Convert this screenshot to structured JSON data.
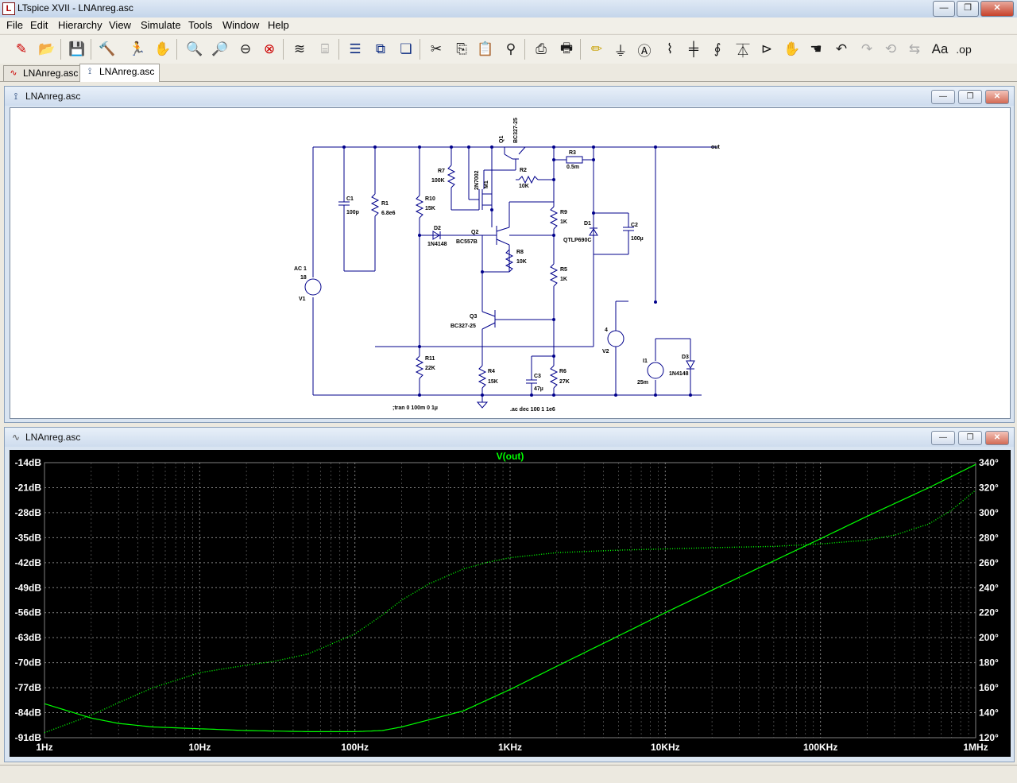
{
  "app": {
    "title": "LTspice XVII - LNAnreg.asc",
    "icon_letter": "L"
  },
  "window_controls": {
    "minimize": "—",
    "restore": "❐",
    "close": "✕"
  },
  "menu": [
    "File",
    "Edit",
    "Hierarchy",
    "View",
    "Simulate",
    "Tools",
    "Window",
    "Help"
  ],
  "tabs": [
    {
      "label": "LNAnreg.asc",
      "kind": "waveform",
      "active": false
    },
    {
      "label": "LNAnreg.asc",
      "kind": "schematic",
      "active": true
    }
  ],
  "schematic_window": {
    "title": "LNAnreg.asc",
    "labels": {
      "q1": "Q1",
      "q1_model": "BC327-25",
      "out": "out",
      "r3": "R3",
      "r3_val": "0.5m",
      "r2": "R2",
      "r2_val": "10K",
      "r7": "R7",
      "r7_val": "100K",
      "m1": "M1",
      "m1_model": "2N7002",
      "c1": "C1",
      "c1_val": "100p",
      "r1": "R1",
      "r1_val": "6.8e6",
      "r10": "R10",
      "r10_val": "15K",
      "r9": "R9",
      "r9_val": "1K",
      "d1": "D1",
      "d1_model": "QTLP690C",
      "c2": "C2",
      "c2_val": "100µ",
      "d2": "D2",
      "d2_model": "1N4148",
      "q2": "Q2",
      "q2_model": "BC557B",
      "r8": "R8",
      "r8_val": "10K",
      "r5": "R5",
      "r5_val": "1K",
      "v1": "V1",
      "v1_ac": "AC 1",
      "v1_val": "18",
      "q3": "Q3",
      "q3_model": "BC327-25",
      "v2": "V2",
      "v2_val": "4",
      "i1": "I1",
      "i1_val": "25m",
      "d3": "D3",
      "d3_model": "1N4148",
      "r11": "R11",
      "r11_val": "22K",
      "r4": "R4",
      "r4_val": "15K",
      "c3": "C3",
      "c3_val": "47µ",
      "r6": "R6",
      "r6_val": "27K",
      "tran": ";tran 0 100m 0 1µ",
      "ac": ".ac dec 100 1 1e6"
    }
  },
  "waveform_window": {
    "title": "LNAnreg.asc",
    "trace_name": "V(out)",
    "trace_color": "#00ff00",
    "background": "#000000"
  },
  "chart_data": {
    "type": "line",
    "title": "V(out)",
    "x_scale": "log",
    "xlim": [
      1,
      1000000
    ],
    "x_tick_labels": [
      "1Hz",
      "10Hz",
      "100Hz",
      "1KHz",
      "10KHz",
      "100KHz",
      "1MHz"
    ],
    "x_tick_values": [
      1,
      10,
      100,
      1000,
      10000,
      100000,
      1000000
    ],
    "y_left_label_unit": "dB",
    "ylim_left": [
      -91,
      -14
    ],
    "y_left_ticks": [
      -14,
      -21,
      -28,
      -35,
      -42,
      -49,
      -56,
      -63,
      -70,
      -77,
      -84,
      -91
    ],
    "y_left_tick_labels": [
      "-14dB",
      "-21dB",
      "-28dB",
      "-35dB",
      "-42dB",
      "-49dB",
      "-56dB",
      "-63dB",
      "-70dB",
      "-77dB",
      "-84dB",
      "-91dB"
    ],
    "ylim_right": [
      120,
      340
    ],
    "y_right_ticks": [
      340,
      320,
      300,
      280,
      260,
      240,
      220,
      200,
      180,
      160,
      140,
      120
    ],
    "y_right_tick_labels": [
      "340°",
      "320°",
      "300°",
      "280°",
      "260°",
      "240°",
      "220°",
      "200°",
      "180°",
      "160°",
      "140°",
      "120°"
    ],
    "grid": true,
    "series": [
      {
        "name": "V(out)",
        "axis": "left",
        "style": "solid",
        "x": [
          1,
          2,
          3,
          5,
          10,
          20,
          50,
          100,
          150,
          200,
          300,
          500,
          1000,
          2000,
          5000,
          10000,
          20000,
          50000,
          100000,
          200000,
          500000,
          1000000
        ],
        "y": [
          -81.5,
          -85.5,
          -87,
          -88,
          -88.5,
          -89,
          -89.3,
          -89.3,
          -89,
          -88,
          -86,
          -83.5,
          -77.5,
          -71,
          -62.5,
          -56,
          -49.7,
          -41.5,
          -35.3,
          -29,
          -21,
          -14.5
        ]
      },
      {
        "name": "V(out) phase",
        "axis": "right",
        "style": "dotted",
        "x": [
          1,
          2,
          3,
          5,
          10,
          20,
          30,
          50,
          100,
          150,
          200,
          300,
          500,
          700,
          1000,
          2000,
          5000,
          10000,
          20000,
          50000,
          100000,
          200000,
          300000,
          500000,
          700000,
          1000000
        ],
        "y": [
          124,
          138,
          148,
          160,
          172,
          178,
          181,
          187,
          203,
          218,
          230,
          243,
          255,
          260,
          264,
          268,
          270,
          271,
          272,
          273,
          275,
          278,
          282,
          291,
          302,
          318
        ]
      }
    ]
  },
  "status": {
    "text": ""
  }
}
